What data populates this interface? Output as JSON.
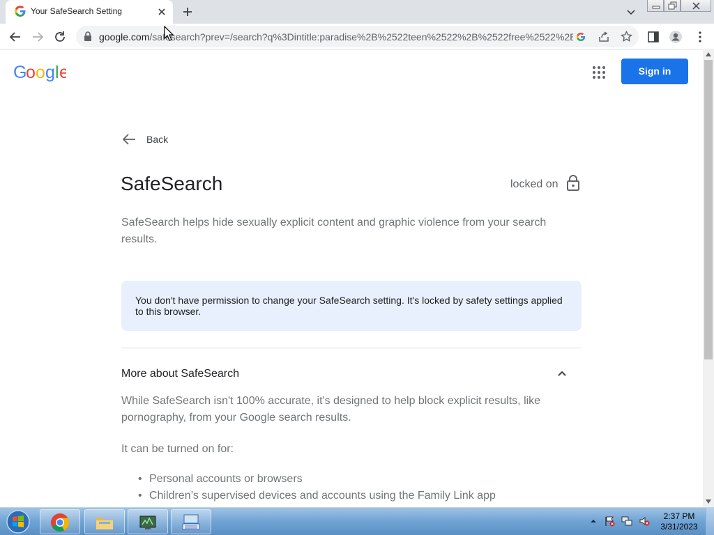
{
  "browser": {
    "tab": {
      "title": "Your SafeSearch Setting"
    },
    "address": {
      "host": "google.com",
      "path": "/safesearch?prev=/search?q%3Dintitle:paradise%2B%2522teen%2522%2B%2522free%2522%2B..."
    }
  },
  "header": {
    "logo": "Google",
    "signin_label": "Sign in"
  },
  "main": {
    "back_label": "Back",
    "title": "SafeSearch",
    "status_label": "locked on",
    "description": "SafeSearch helps hide sexually explicit content and graphic violence from your search results.",
    "notice": "You don't have permission to change your SafeSearch setting. It's locked by safety settings applied to this browser.",
    "more": {
      "heading": "More about SafeSearch",
      "body": "While SafeSearch isn't 100% accurate, it's designed to help block explicit results, like pornography, from your Google search results.",
      "turned_on_for": "It can be turned on for:",
      "bullets": [
        "Personal accounts or browsers",
        "Children’s supervised devices and accounts using the Family Link app"
      ]
    }
  },
  "taskbar": {
    "time": "2:37 PM",
    "date": "3/31/2023"
  },
  "colors": {
    "accent": "#1a73e8",
    "notice_bg": "#e8f0fe",
    "text": "#202124",
    "muted": "#70757a"
  }
}
